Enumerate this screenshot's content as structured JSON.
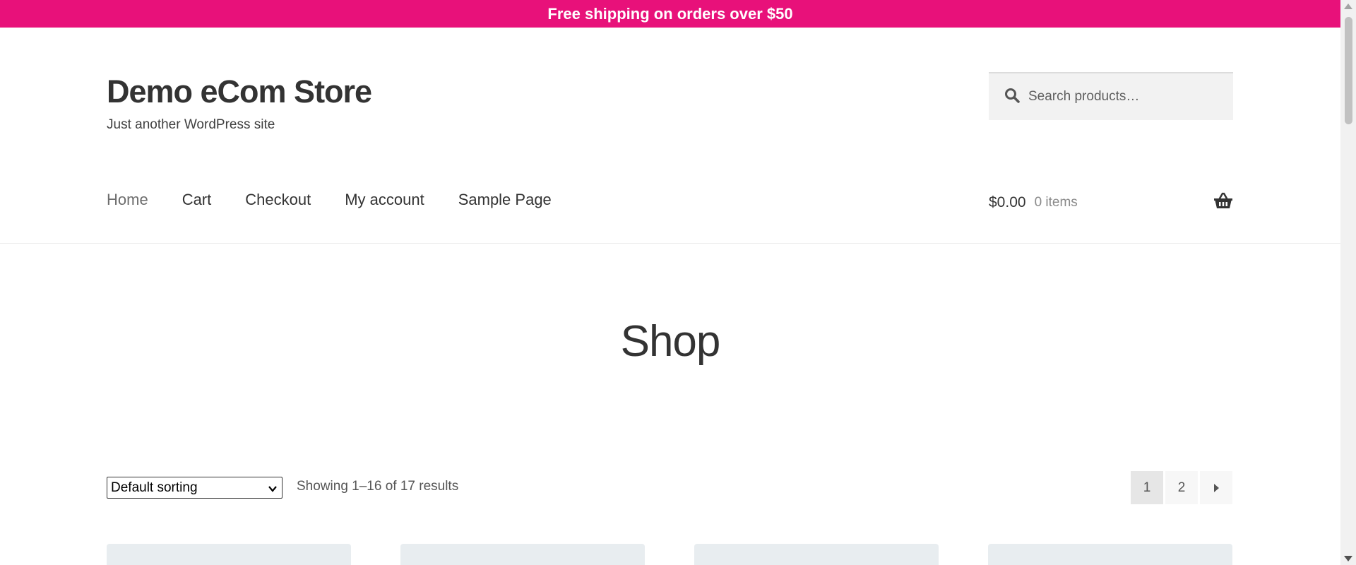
{
  "colors": {
    "banner_bg": "#e8117a",
    "text": "#333333",
    "muted": "#8a8a8a",
    "search_bg": "#f2f2f2",
    "card_bg": "#e8edf0"
  },
  "banner": {
    "text": "Free shipping on orders over $50"
  },
  "header": {
    "site_title": "Demo eCom Store",
    "tagline": "Just another WordPress site",
    "search": {
      "placeholder": "Search products…",
      "value": "",
      "icon": "search-icon"
    }
  },
  "nav": {
    "items": [
      {
        "label": "Home",
        "current": true
      },
      {
        "label": "Cart"
      },
      {
        "label": "Checkout"
      },
      {
        "label": "My account"
      },
      {
        "label": "Sample Page"
      }
    ]
  },
  "cart": {
    "amount": "$0.00",
    "count": "0 items",
    "icon": "basket-icon"
  },
  "main": {
    "page_title": "Shop",
    "sorting": {
      "selected": "Default sorting"
    },
    "result_count": "Showing 1–16 of 17 results",
    "pagination": {
      "pages": [
        "1",
        "2"
      ],
      "current": "1",
      "next_icon": "caret-right-icon"
    }
  }
}
